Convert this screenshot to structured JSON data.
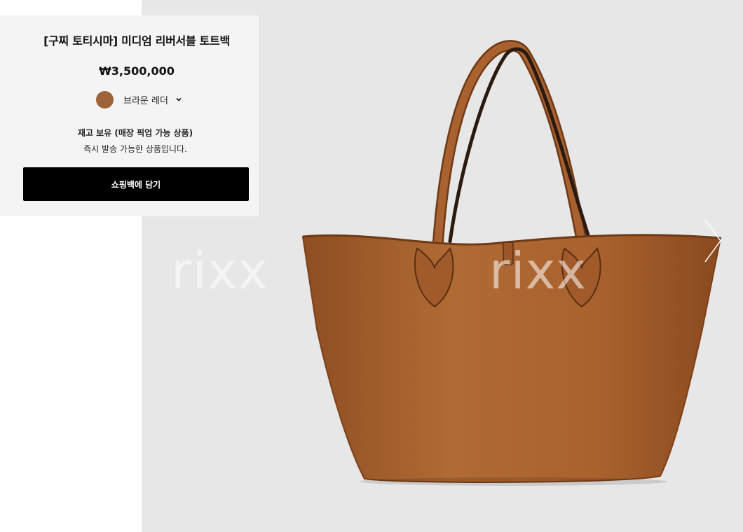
{
  "product": {
    "title": "[구찌 토티시마] 미디엄 리버서블 토트백",
    "price": "₩3,500,000",
    "color": {
      "label": "브라운 레더",
      "swatch_hex": "#9d6238"
    },
    "stock_status": "재고 보유 (매장 픽업 가능 상품)",
    "shipping_note": "즉시 발송 가능한 상품입니다.",
    "add_to_bag_label": "쇼핑백에 담기"
  },
  "gallery": {
    "watermark_text": "rixx",
    "image": "brown-leather-tote-bag",
    "next_icon": "chevron-right-icon"
  },
  "colors": {
    "background": "#e8e7e7",
    "panel": "#f4f4f4",
    "button": "#000000",
    "leather": "#a8612f"
  }
}
